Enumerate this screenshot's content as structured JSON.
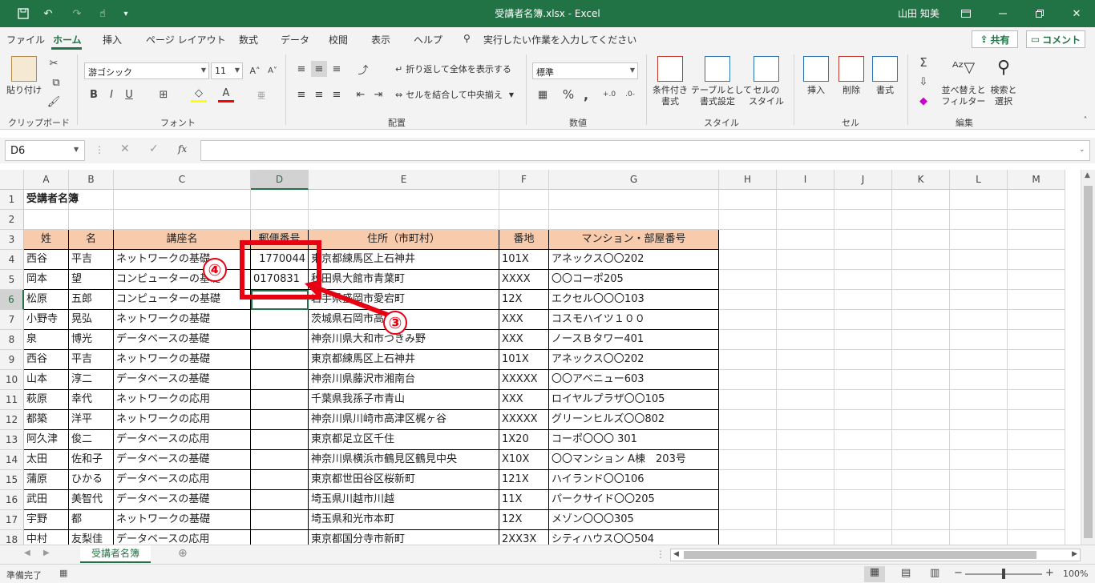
{
  "title": {
    "filename": "受講者名簿.xlsx",
    "sep": "-",
    "app": "Excel",
    "user": "山田 知美"
  },
  "menu": {
    "tabs": [
      "ファイル",
      "ホーム",
      "挿入",
      "ページ レイアウト",
      "数式",
      "データ",
      "校閲",
      "表示",
      "ヘルプ"
    ],
    "search": "実行したい作業を入力してください",
    "share": "共有",
    "comment": "コメント"
  },
  "ribbon": {
    "clipboard": {
      "paste": "貼り付け",
      "label": "クリップボード"
    },
    "font": {
      "name": "游ゴシック",
      "size": "11",
      "label": "フォント"
    },
    "align": {
      "wrap": "折り返して全体を表示する",
      "merge": "セルを結合して中央揃え",
      "label": "配置"
    },
    "number": {
      "format": "標準",
      "label": "数値"
    },
    "styles": {
      "cond": "条件付き\n書式",
      "table": "テーブルとして\n書式設定",
      "cell": "セルの\nスタイル",
      "label": "スタイル"
    },
    "cells": {
      "insert": "挿入",
      "delete": "削除",
      "format": "書式",
      "label": "セル"
    },
    "editing": {
      "sort": "並べ替えと\nフィルター",
      "find": "検索と\n選択",
      "label": "編集"
    }
  },
  "namebox": "D6",
  "fx": "fx",
  "columns": [
    "A",
    "B",
    "C",
    "D",
    "E",
    "F",
    "G",
    "H",
    "I",
    "J",
    "K",
    "L",
    "M"
  ],
  "rows": [
    [
      "受講者名簿",
      "",
      "",
      "",
      "",
      "",
      ""
    ],
    [
      "",
      "",
      "",
      "",
      "",
      "",
      ""
    ],
    [
      "姓",
      "名",
      "講座名",
      "郵便番号",
      "住所（市町村）",
      "番地",
      "マンション・部屋番号"
    ],
    [
      "西谷",
      "平吉",
      "ネットワークの基礎",
      "1770044",
      "東京都練馬区上石神井",
      "101X",
      "アネックス〇〇202"
    ],
    [
      "岡本",
      "望",
      "コンピューターの基礎",
      "0170831",
      "秋田県大館市青葉町",
      "XXXX",
      "〇〇コーポ205"
    ],
    [
      "松原",
      "五郎",
      "コンピューターの基礎",
      "",
      "岩手県盛岡市愛宕町",
      "12X",
      "エクセル〇〇〇103"
    ],
    [
      "小野寺",
      "晃弘",
      "ネットワークの基礎",
      "",
      "茨城県石岡市高浜",
      "XXX",
      "コスモハイツ１００"
    ],
    [
      "泉",
      "博光",
      "データベースの基礎",
      "",
      "神奈川県大和市つきみ野",
      "XXX",
      "ノースＢタワー401"
    ],
    [
      "西谷",
      "平吉",
      "ネットワークの基礎",
      "",
      "東京都練馬区上石神井",
      "101X",
      "アネックス〇〇202"
    ],
    [
      "山本",
      "淳二",
      "データベースの基礎",
      "",
      "神奈川県藤沢市湘南台",
      "XXXXX",
      "〇〇アベニュー603"
    ],
    [
      "萩原",
      "幸代",
      "ネットワークの応用",
      "",
      "千葉県我孫子市青山",
      "XXX",
      "ロイヤルプラザ〇〇105"
    ],
    [
      "都築",
      "洋平",
      "ネットワークの応用",
      "",
      "神奈川県川崎市高津区梶ヶ谷",
      "XXXXX",
      "グリーンヒルズ〇〇802"
    ],
    [
      "阿久津",
      "俊二",
      "データベースの応用",
      "",
      "東京都足立区千住",
      "1X20",
      "コーポ〇〇〇 301"
    ],
    [
      "太田",
      "佐和子",
      "データベースの基礎",
      "",
      "神奈川県横浜市鶴見区鶴見中央",
      "X10X",
      "〇〇マンション A棟　203号"
    ],
    [
      "蒲原",
      "ひかる",
      "データベースの応用",
      "",
      "東京都世田谷区桜新町",
      "121X",
      "ハイランド〇〇106"
    ],
    [
      "武田",
      "美智代",
      "データベースの基礎",
      "",
      "埼玉県川越市川越",
      "11X",
      "パークサイド〇〇205"
    ],
    [
      "宇野",
      "都",
      "ネットワークの基礎",
      "",
      "埼玉県和光市本町",
      "12X",
      "メゾン〇〇〇305"
    ],
    [
      "中村",
      "友梨佳",
      "データベースの応用",
      "",
      "東京都国分寺市新町",
      "2XX3X",
      "シティハウス〇〇504"
    ]
  ],
  "sheet_tab": "受講者名簿",
  "status": {
    "ready": "準備完了",
    "zoom": "100%"
  },
  "callouts": {
    "three": "③",
    "four": "④"
  },
  "accent": "#217346",
  "header_fill": "#f8cbad",
  "highlight": "#e60012"
}
